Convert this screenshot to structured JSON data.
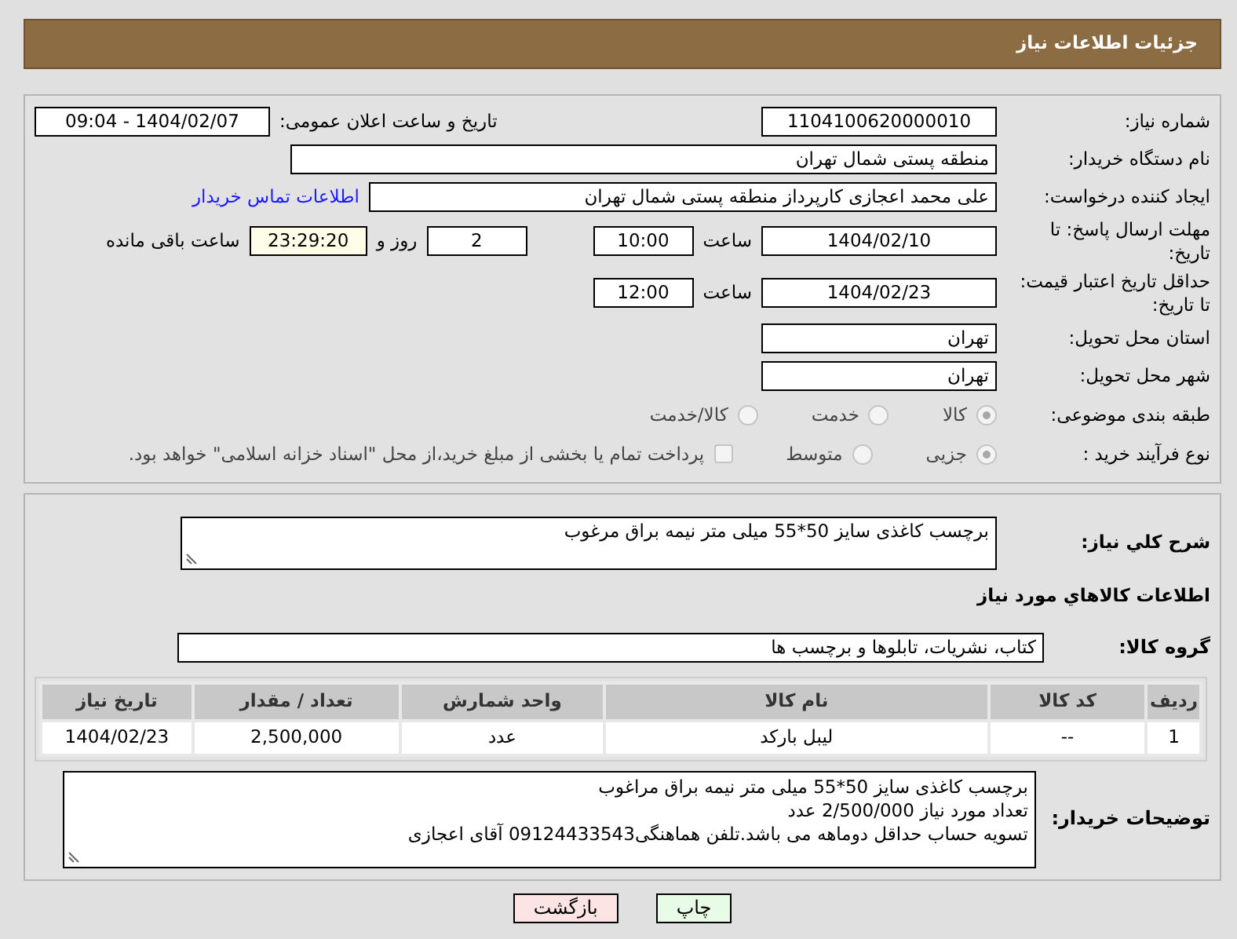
{
  "header": {
    "title": "جزئیات اطلاعات نیاز"
  },
  "need_number": {
    "label": "شماره نیاز:",
    "value": "1104100620000010"
  },
  "announce": {
    "label": "تاریخ و ساعت اعلان عمومی:",
    "value": "1404/02/07 - 09:04"
  },
  "buyer_org": {
    "label": "نام دستگاه خریدار:",
    "value": "منطقه پستی شمال تهران"
  },
  "requester": {
    "label": "ایجاد کننده درخواست:",
    "value": "علی محمد اعجازی کارپرداز منطقه پستی شمال تهران",
    "link": "اطلاعات تماس خریدار"
  },
  "reply_deadline": {
    "label": "مهلت ارسال پاسخ: تا تاریخ:",
    "date": "1404/02/10",
    "time_label": "ساعت",
    "time": "10:00",
    "days": "2",
    "days_label": "روز و",
    "remaining": "23:29:20",
    "remaining_label": "ساعت باقی مانده"
  },
  "price_validity": {
    "label": "حداقل تاریخ اعتبار قیمت: تا تاریخ:",
    "date": "1404/02/23",
    "time_label": "ساعت",
    "time": "12:00"
  },
  "province": {
    "label": "استان محل تحویل:",
    "value": "تهران"
  },
  "city": {
    "label": "شهر محل تحویل:",
    "value": "تهران"
  },
  "category": {
    "label": "طبقه بندی موضوعی:",
    "options": [
      {
        "label": "کالا",
        "selected": true
      },
      {
        "label": "خدمت",
        "selected": false
      },
      {
        "label": "کالا/خدمت",
        "selected": false
      }
    ]
  },
  "process": {
    "label": "نوع فرآیند خرید :",
    "options": [
      {
        "label": "جزیی",
        "selected": true
      },
      {
        "label": "متوسط",
        "selected": false
      }
    ],
    "treasury": {
      "label": "پرداخت تمام یا بخشی از مبلغ خرید،از محل \"اسناد خزانه اسلامی\" خواهد بود.",
      "checked": false
    }
  },
  "summary": {
    "label": "شرح کلي نياز:",
    "value": "برچسب کاغذی سایز 50*55 میلی متر نیمه براق مرغوب"
  },
  "goods_section": {
    "title": "اطلاعات کالاهاي مورد نياز"
  },
  "goods_group": {
    "label": "گروه کالا:",
    "value": "کتاب، نشریات، تابلوها و برچسب ها"
  },
  "table": {
    "columns": [
      "ردیف",
      "کد کالا",
      "نام کالا",
      "واحد شمارش",
      "تعداد / مقدار",
      "تاریخ نیاز"
    ],
    "rows": [
      [
        "1",
        "--",
        "لیبل بارکد",
        "عدد",
        "2,500,000",
        "1404/02/23"
      ]
    ]
  },
  "buyer_notes": {
    "label": "توضیحات خریدار:",
    "lines": [
      "برچسب کاغذی سایز 50*55 میلی متر نیمه براق مراغوب",
      "تعداد مورد نیاز 2/500/000 عدد",
      "تسویه حساب حداقل دوماهه می باشد.تلفن هماهنگی09124433543 آقای اعجازی"
    ]
  },
  "buttons": [
    {
      "label": "چاپ",
      "kind": "print"
    },
    {
      "label": "بازگشت",
      "kind": "back"
    }
  ]
}
